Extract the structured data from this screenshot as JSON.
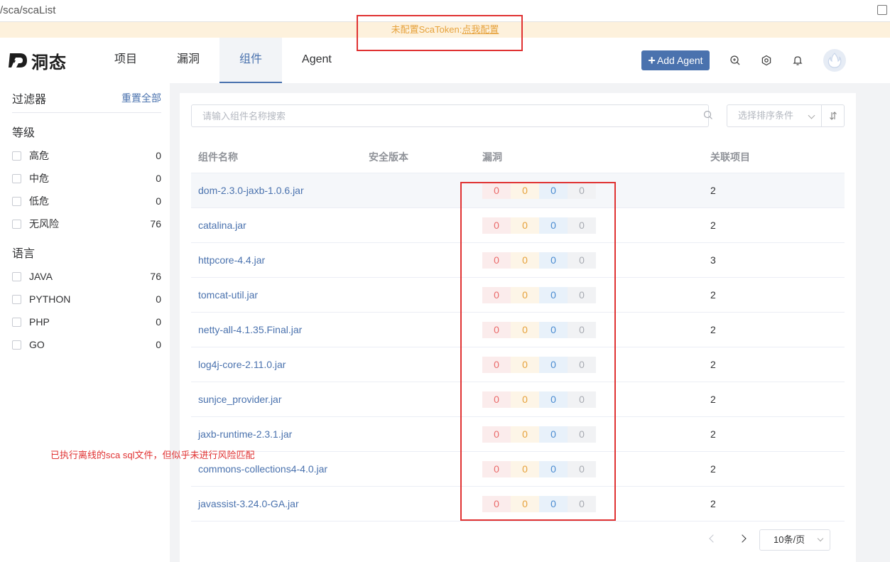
{
  "browser": {
    "url": "/sca/scaList"
  },
  "banner": {
    "text": "未配置ScaToken:",
    "link": "点我配置"
  },
  "header": {
    "logo_text": "洞态",
    "nav": [
      {
        "label": "项目",
        "active": false
      },
      {
        "label": "漏洞",
        "active": false
      },
      {
        "label": "组件",
        "active": true
      },
      {
        "label": "Agent",
        "active": false
      }
    ],
    "add_agent_label": "Add Agent"
  },
  "sidebar": {
    "title": "过滤器",
    "reset_label": "重置全部",
    "level_group": "等级",
    "levels": [
      {
        "label": "高危",
        "count": "0"
      },
      {
        "label": "中危",
        "count": "0"
      },
      {
        "label": "低危",
        "count": "0"
      },
      {
        "label": "无风险",
        "count": "76"
      }
    ],
    "lang_group": "语言",
    "languages": [
      {
        "label": "JAVA",
        "count": "76"
      },
      {
        "label": "PYTHON",
        "count": "0"
      },
      {
        "label": "PHP",
        "count": "0"
      },
      {
        "label": "GO",
        "count": "0"
      }
    ]
  },
  "main": {
    "search_placeholder": "请输入组件名称搜索",
    "sort_placeholder": "选择排序条件",
    "columns": {
      "name": "组件名称",
      "safe_version": "安全版本",
      "vuln": "漏洞",
      "projects": "关联项目"
    },
    "rows": [
      {
        "name": "dom-2.3.0-jaxb-1.0.6.jar",
        "high": "0",
        "mid": "0",
        "low": "0",
        "none": "0",
        "projects": "2"
      },
      {
        "name": "catalina.jar",
        "high": "0",
        "mid": "0",
        "low": "0",
        "none": "0",
        "projects": "2"
      },
      {
        "name": "httpcore-4.4.jar",
        "high": "0",
        "mid": "0",
        "low": "0",
        "none": "0",
        "projects": "3"
      },
      {
        "name": "tomcat-util.jar",
        "high": "0",
        "mid": "0",
        "low": "0",
        "none": "0",
        "projects": "2"
      },
      {
        "name": "netty-all-4.1.35.Final.jar",
        "high": "0",
        "mid": "0",
        "low": "0",
        "none": "0",
        "projects": "2"
      },
      {
        "name": "log4j-core-2.11.0.jar",
        "high": "0",
        "mid": "0",
        "low": "0",
        "none": "0",
        "projects": "2"
      },
      {
        "name": "sunjce_provider.jar",
        "high": "0",
        "mid": "0",
        "low": "0",
        "none": "0",
        "projects": "2"
      },
      {
        "name": "jaxb-runtime-2.3.1.jar",
        "high": "0",
        "mid": "0",
        "low": "0",
        "none": "0",
        "projects": "2"
      },
      {
        "name": "commons-collections4-4.0.jar",
        "high": "0",
        "mid": "0",
        "low": "0",
        "none": "0",
        "projects": "2"
      },
      {
        "name": "javassist-3.24.0-GA.jar",
        "high": "0",
        "mid": "0",
        "low": "0",
        "none": "0",
        "projects": "2"
      }
    ],
    "page_size": "10条/页"
  },
  "annotation": {
    "note": "已执行离线的sca sql文件，但似乎未进行风险匹配",
    "color": "#e03232"
  }
}
